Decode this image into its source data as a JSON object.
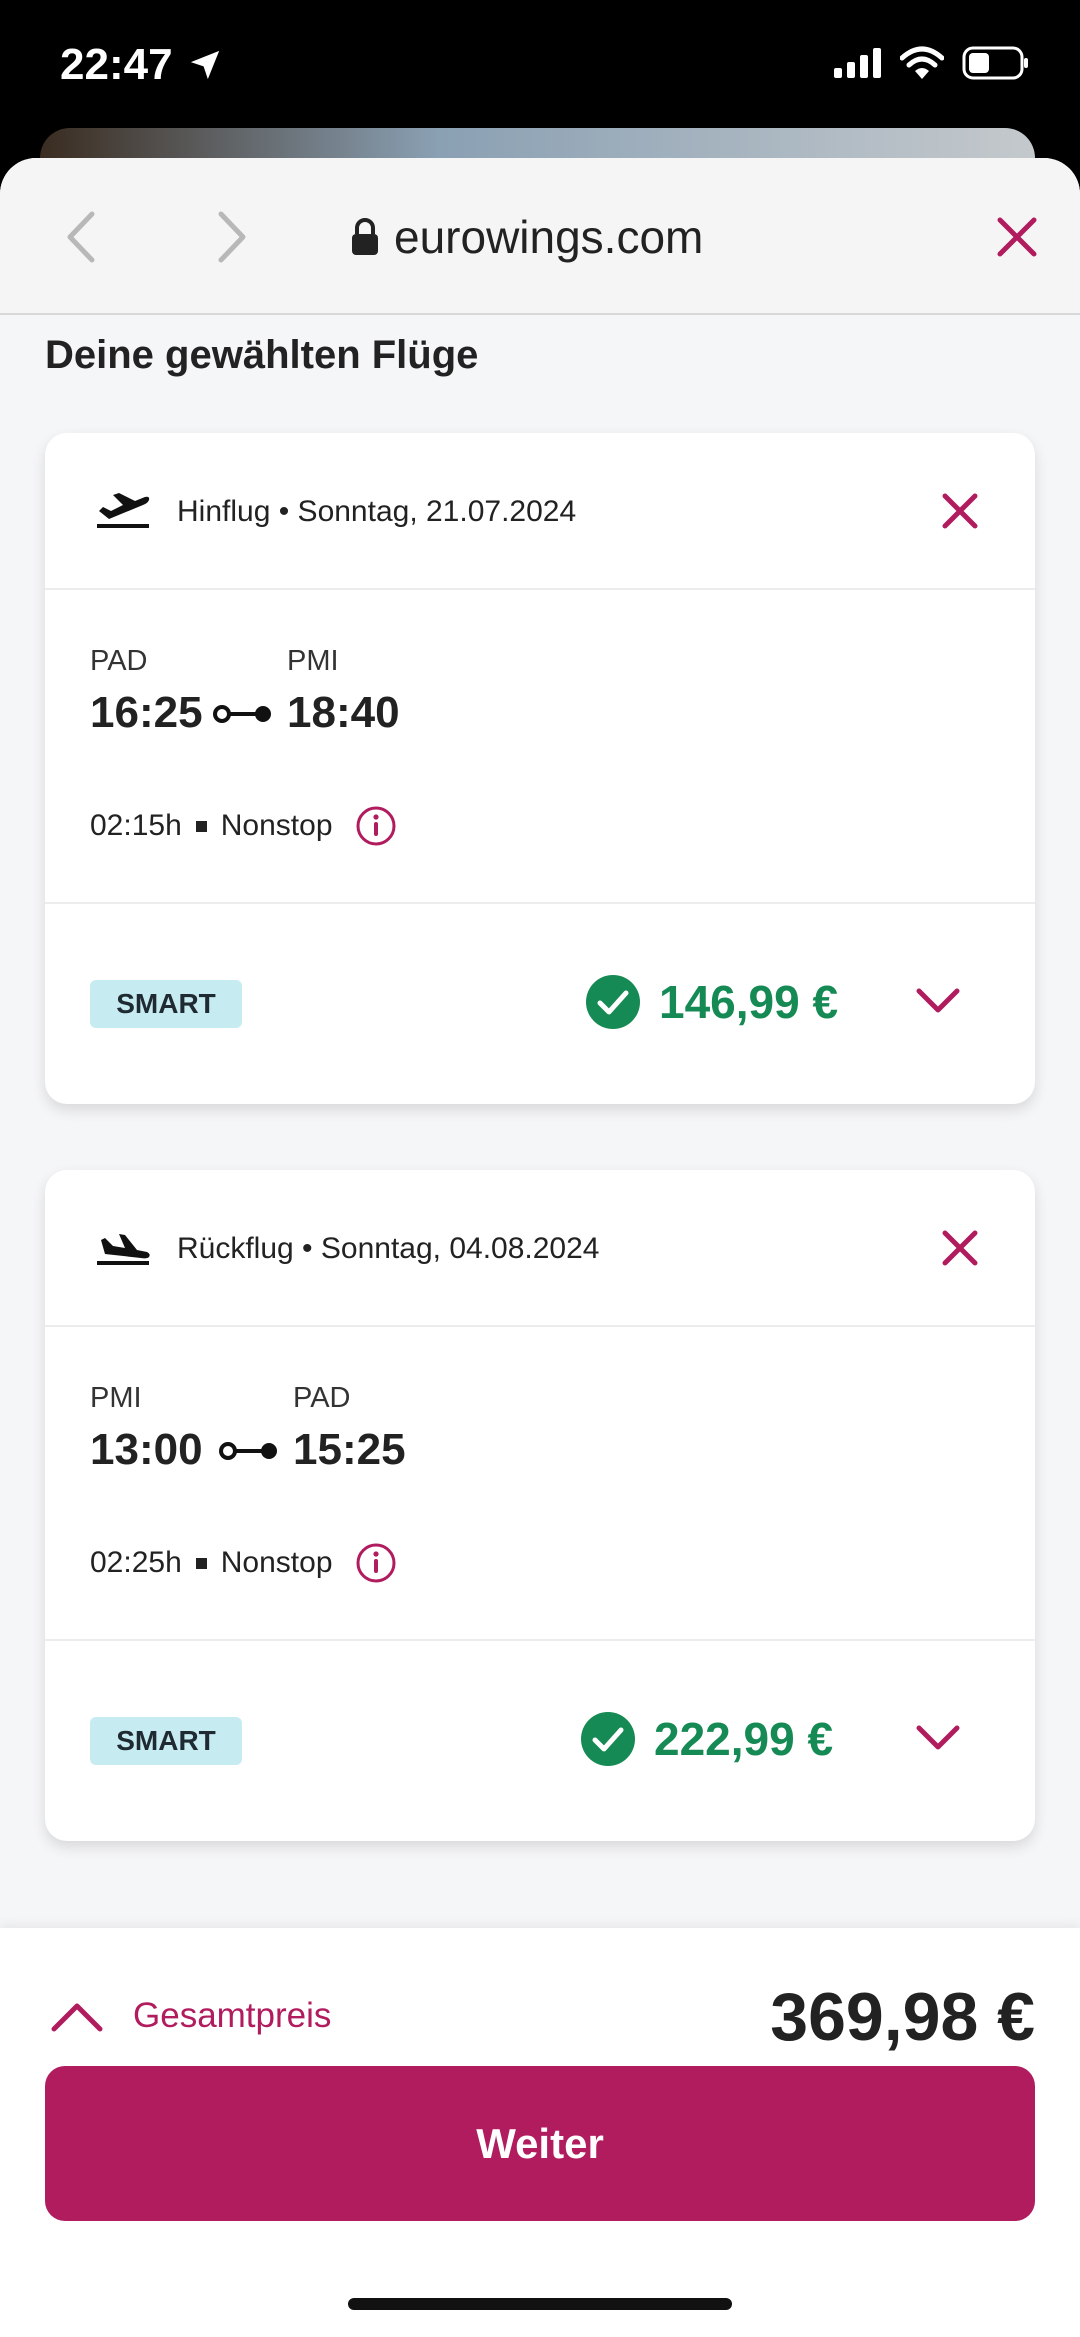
{
  "status_bar": {
    "time": "22:47"
  },
  "browser": {
    "url": "eurowings.com"
  },
  "heading": "Deine gewählten Flüge",
  "flights": [
    {
      "title": "Hinflug • Sonntag, 21.07.2024",
      "from_code": "PAD",
      "from_time": "16:25",
      "to_code": "PMI",
      "to_time": "18:40",
      "duration": "02:15h",
      "stops": "Nonstop",
      "fare": "SMART",
      "price": "146,99 €"
    },
    {
      "title": "Rückflug • Sonntag, 04.08.2024",
      "from_code": "PMI",
      "from_time": "13:00",
      "to_code": "PAD",
      "to_time": "15:25",
      "duration": "02:25h",
      "stops": "Nonstop",
      "fare": "SMART",
      "price": "222,99 €"
    }
  ],
  "total": {
    "label": "Gesamtpreis",
    "value": "369,98 €"
  },
  "continue_label": "Weiter",
  "colors": {
    "accent": "#b01c5e",
    "price_green": "#168a54",
    "badge_bg": "#c6ecf2"
  }
}
